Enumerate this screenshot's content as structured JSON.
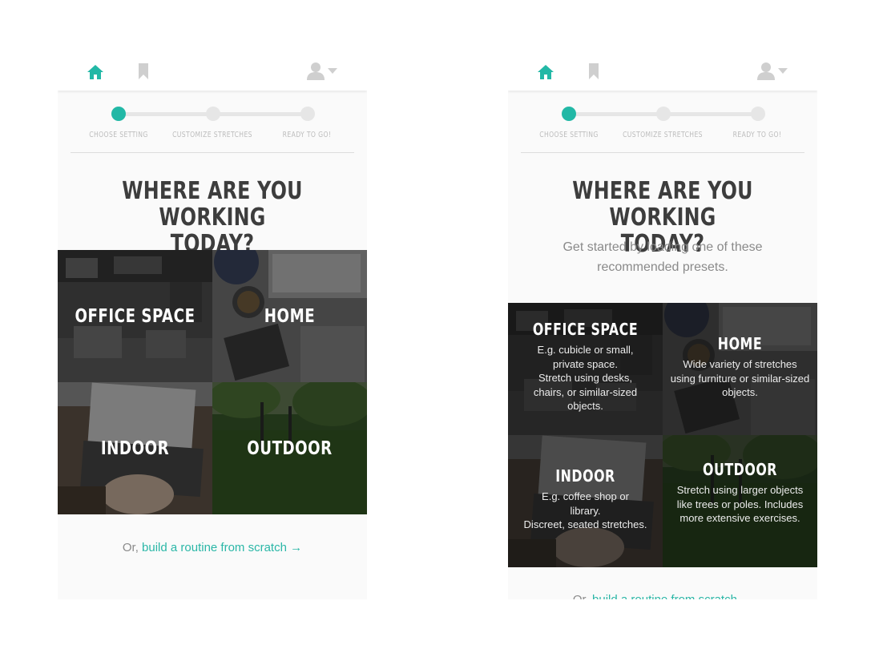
{
  "colors": {
    "accent": "#22b8a6",
    "heading": "#3d3d3d",
    "muted": "#8a8a8a",
    "step_inactive": "#e6e6e6"
  },
  "nav": {
    "home_icon": "home-icon",
    "bookmark_icon": "bookmark-icon",
    "user_icon": "user-icon",
    "caret_icon": "caret-down-icon"
  },
  "steps": [
    {
      "label": "CHOOSE SETTING",
      "active": true
    },
    {
      "label": "CUSTOMIZE STRETCHES",
      "active": false
    },
    {
      "label": "READY TO GO!",
      "active": false
    }
  ],
  "heading": {
    "line1": "WHERE ARE YOU WORKING",
    "line2": "TODAY?"
  },
  "subtitle": "Get started by loading one of these recommended presets.",
  "settings": {
    "office": {
      "title": "OFFICE SPACE",
      "desc_line1": "E.g. cubicle or small, private space.",
      "desc_line2": "Stretch using desks, chairs, or similar-sized objects."
    },
    "home": {
      "title": "HOME",
      "desc": "Wide variety of stretches using furniture or similar-sized objects."
    },
    "indoor": {
      "title": "INDOOR",
      "desc_line1": "E.g. coffee shop or library.",
      "desc_line2": "Discreet, seated stretches."
    },
    "outdoor": {
      "title": "OUTDOOR",
      "desc": "Stretch using larger objects like trees or poles. Includes more extensive exercises."
    }
  },
  "footer": {
    "prefix": "Or, ",
    "link": "build a routine from scratch →"
  }
}
